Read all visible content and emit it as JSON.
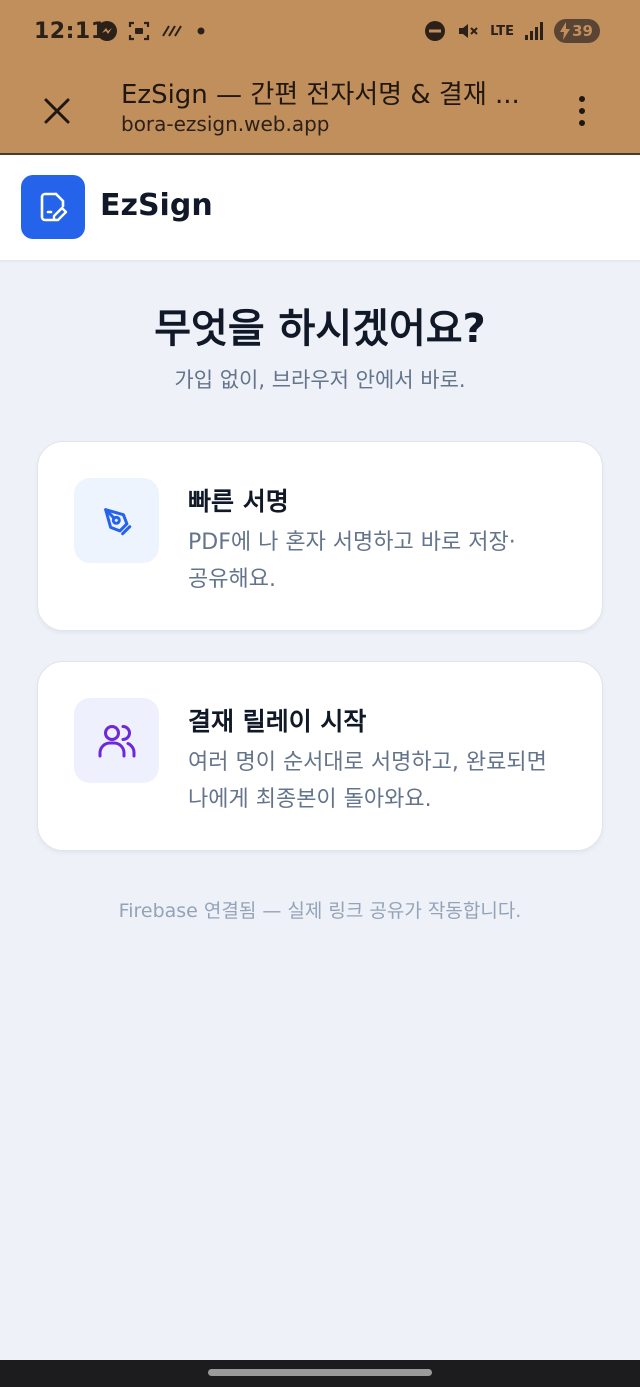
{
  "status_bar": {
    "time": "12:11",
    "network": "LTE",
    "battery": "39",
    "icons": [
      "messenger-icon",
      "screenshot-icon",
      "nfc-icon",
      "dot-icon",
      "do-not-disturb-icon",
      "mute-icon",
      "signal-icon",
      "battery-icon"
    ]
  },
  "browser": {
    "title": "EzSign — 간편 전자서명 & 결재 ...",
    "url": "bora-ezsign.web.app",
    "close_icon": "close-icon",
    "menu_icon": "more-vert-icon"
  },
  "app_header": {
    "name": "EzSign",
    "logo_icon": "document-edit-icon"
  },
  "main": {
    "headline": "무엇을 하시겠어요?",
    "subline": "가입 없이, 브라우저 안에서 바로.",
    "cards": [
      {
        "icon": "pen-tool-icon",
        "title": "빠른 서명",
        "description": "PDF에 나 혼자 서명하고 바로 저장·공유해요."
      },
      {
        "icon": "users-icon",
        "title": "결재 릴레이 시작",
        "description": "여러 명이 순서대로 서명하고, 완료되면 나에게 최종본이 돌아와요."
      }
    ],
    "footnote": "Firebase 연결됨 — 실제 링크 공유가 작동합니다."
  },
  "colors": {
    "browser_chrome": "#c18f5c",
    "accent": "#2563eb",
    "page_background": "#eef2f8",
    "users_icon": "#6d28d9"
  }
}
